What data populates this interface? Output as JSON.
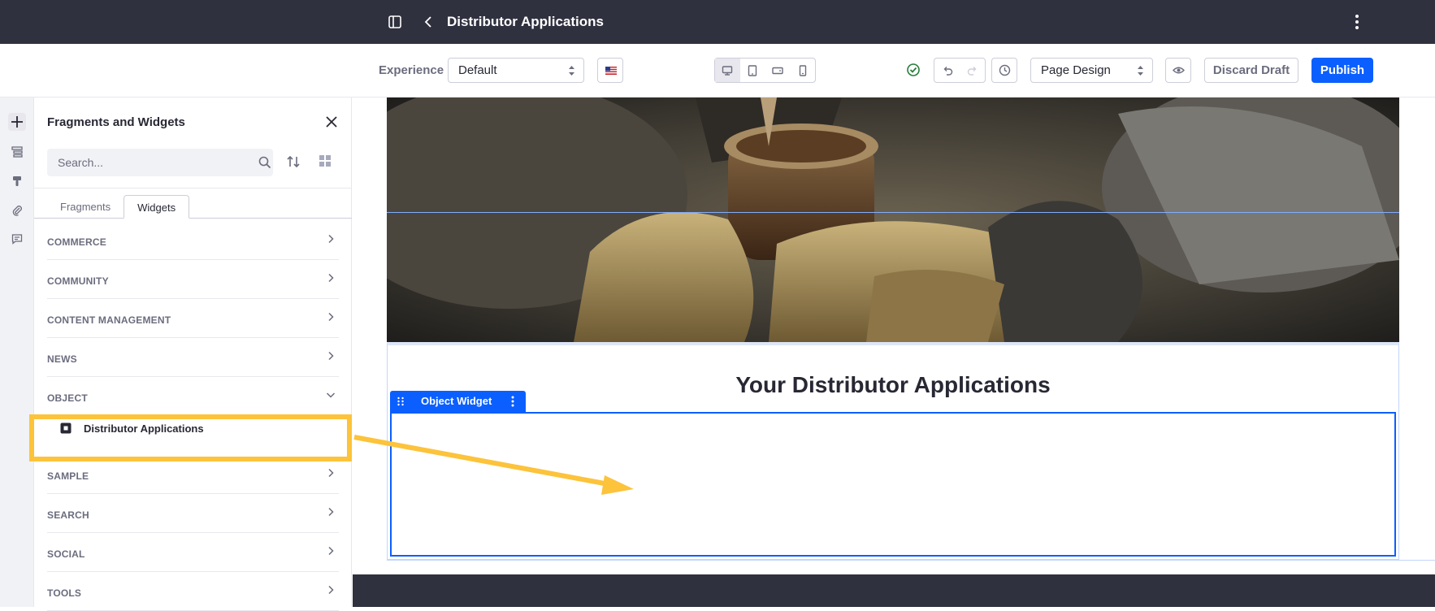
{
  "topbar": {
    "title": "Distributor Applications"
  },
  "toolbar": {
    "experience_label": "Experience",
    "experience_value": "Default",
    "mode_value": "Page Design",
    "discard_label": "Discard Draft",
    "publish_label": "Publish",
    "active_device": "desktop"
  },
  "sidebar": {
    "title": "Fragments and Widgets",
    "search_placeholder": "Search...",
    "tabs": [
      {
        "label": "Fragments",
        "active": false
      },
      {
        "label": "Widgets",
        "active": true
      }
    ],
    "categories": [
      {
        "label": "COMMERCE",
        "expanded": false
      },
      {
        "label": "COMMUNITY",
        "expanded": false
      },
      {
        "label": "CONTENT MANAGEMENT",
        "expanded": false
      },
      {
        "label": "NEWS",
        "expanded": false
      },
      {
        "label": "OBJECT",
        "expanded": true
      },
      {
        "label": "SAMPLE",
        "expanded": false
      },
      {
        "label": "SEARCH",
        "expanded": false
      },
      {
        "label": "SOCIAL",
        "expanded": false
      },
      {
        "label": "TOOLS",
        "expanded": false
      }
    ],
    "object_items": [
      {
        "label": "Distributor Applications"
      }
    ]
  },
  "canvas": {
    "heading": "Your Distributor Applications",
    "widget_label": "Object Widget"
  },
  "colors": {
    "topbar_bg": "#30313f",
    "primary": "#0b5fff",
    "highlight": "#fcc33b",
    "success": "#287d3c"
  }
}
